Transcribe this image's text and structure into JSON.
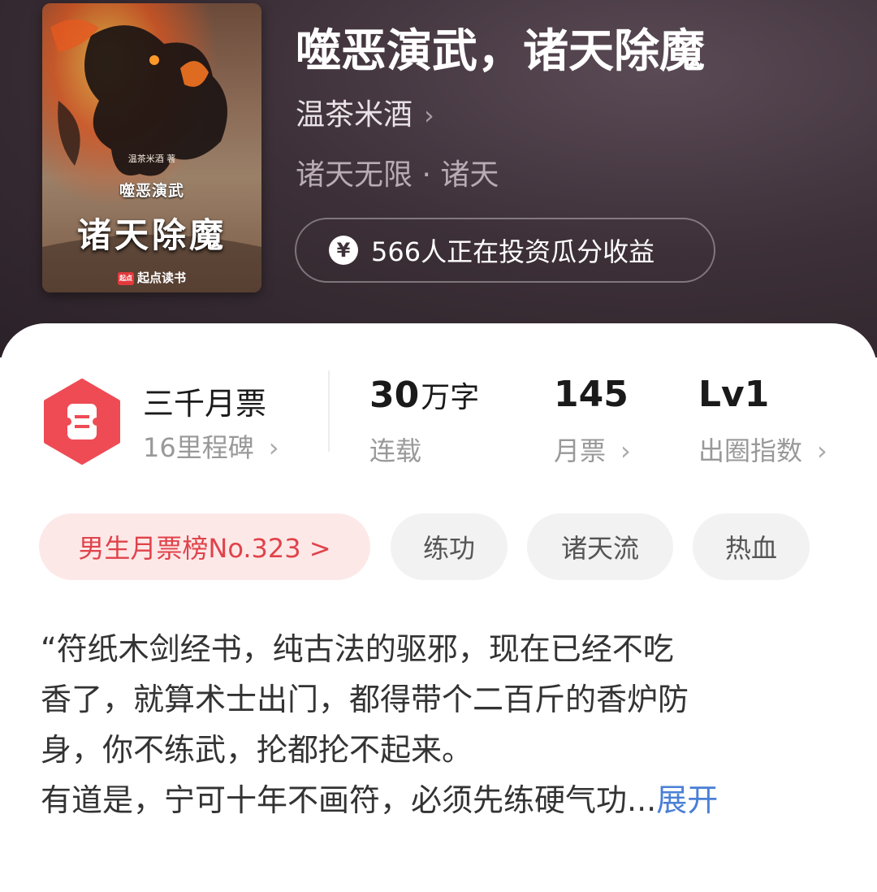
{
  "book": {
    "title": "噬恶演武，诸天除魔",
    "author": "温茶米酒",
    "author_chevron": "›",
    "genre": "诸天无限 · 诸天",
    "invest_icon": "yen-icon",
    "invest_symbol": "¥",
    "invest_text": "566人正在投资瓜分收益"
  },
  "cover": {
    "author_note": "温茶米酒 著",
    "subtitle": "噬恶演武",
    "main_title": "诸天除魔",
    "brand_logo": "起点",
    "brand": "起点读书"
  },
  "stats": {
    "badge_icon": "ticket-icon",
    "badge_color": "#ee4b55",
    "milestone_title": "三千月票",
    "milestone_sub": "16里程碑",
    "words_value": "30",
    "words_unit": "万字",
    "words_label": "连载",
    "tickets_value": "145",
    "tickets_label": "月票",
    "influence_value": "Lv1",
    "influence_label": "出圈指数",
    "chevron": "›"
  },
  "tags": {
    "rank": "男生月票榜No.323 >",
    "items": [
      "练功",
      "诸天流",
      "热血"
    ]
  },
  "description": {
    "lines": [
      "“符纸木剑经书，纯古法的驱邪，现在已经不吃",
      "香了，就算术士出门，都得带个二百斤的香炉防",
      "身，你不练武，抡都抡不起来。",
      "有道是，宁可十年不画符，必须先练硬气功..."
    ],
    "expand_label": "展开"
  },
  "colors": {
    "accent_red": "#e0434a",
    "link_blue": "#4a7fd6",
    "hero_bg": "#3d3038"
  }
}
